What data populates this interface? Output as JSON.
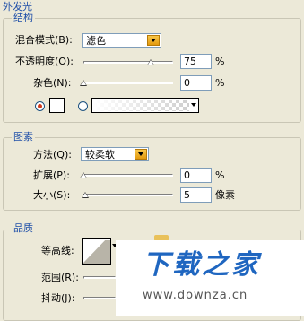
{
  "panel_title": "外发光",
  "structure": {
    "title": "结构",
    "blend_mode": {
      "label": "混合模式(B):",
      "value": "滤色"
    },
    "opacity": {
      "label": "不透明度(O):",
      "value": "75",
      "unit": "%",
      "level": 0.75
    },
    "noise": {
      "label": "杂色(N):",
      "value": "0",
      "unit": "%",
      "level": 0
    },
    "color_swatch_color": "#ffffff"
  },
  "elements": {
    "title": "图素",
    "technique": {
      "label": "方法(Q):",
      "value": "较柔软"
    },
    "spread": {
      "label": "扩展(P):",
      "value": "0",
      "unit": "%",
      "level": 0
    },
    "size": {
      "label": "大小(S):",
      "value": "5",
      "unit": "像素",
      "level": 0.02
    }
  },
  "quality": {
    "title": "品质",
    "contour_label": "等高线:",
    "range_label": "范围(R):",
    "jitter_label": "抖动(J):"
  },
  "watermark": {
    "brand": "下载之家",
    "url": "www.downza.cn",
    "brand_color": "#1f66c0"
  }
}
